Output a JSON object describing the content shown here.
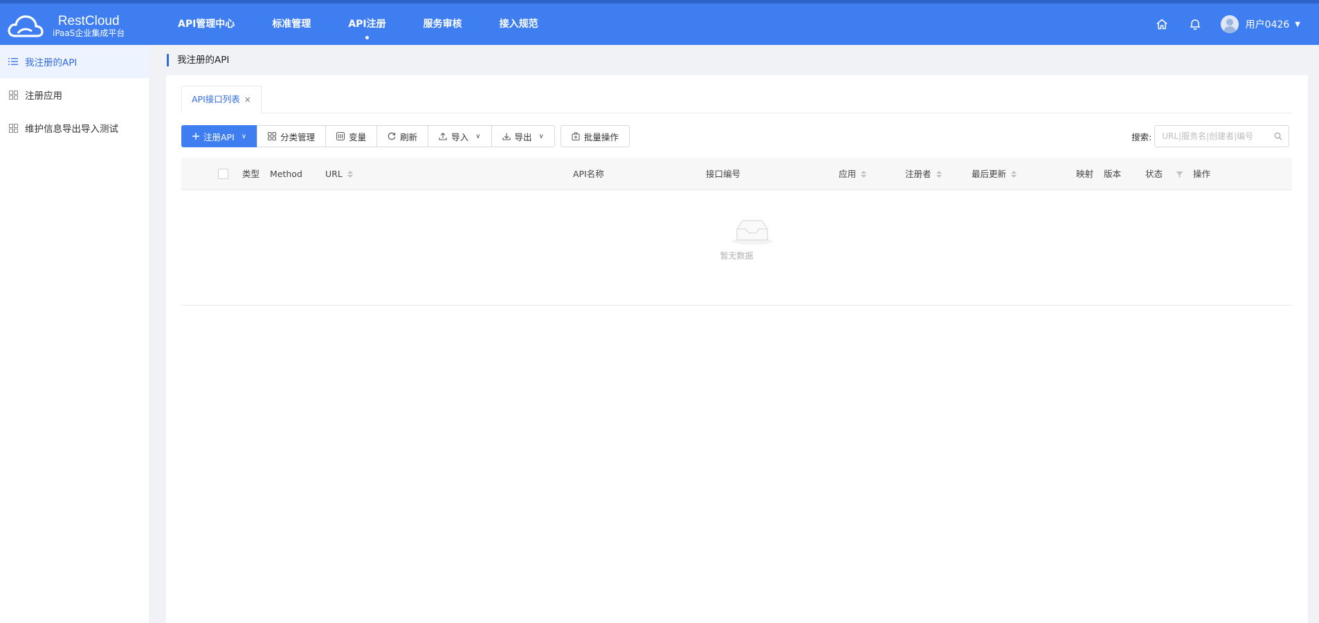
{
  "brand": {
    "title": "RestCloud",
    "subtitle": "iPaaS企业集成平台"
  },
  "nav": [
    {
      "label": "API管理中心"
    },
    {
      "label": "标准管理"
    },
    {
      "label": "API注册",
      "active": true
    },
    {
      "label": "服务审核"
    },
    {
      "label": "接入规范"
    }
  ],
  "user": {
    "name": "用户0426"
  },
  "sidebar": {
    "items": [
      {
        "label": "我注册的API",
        "icon": "list-icon",
        "active": true
      },
      {
        "label": "注册应用",
        "icon": "grid-icon"
      },
      {
        "label": "维护信息导出导入测试",
        "icon": "grid-icon"
      }
    ]
  },
  "page": {
    "title": "我注册的API"
  },
  "tabs": [
    {
      "label": "API接口列表",
      "close": "×"
    }
  ],
  "toolbar": {
    "register": "注册API",
    "category": "分类管理",
    "variables": "变量",
    "refresh": "刷新",
    "import": "导入",
    "export": "导出",
    "batch": "批量操作"
  },
  "search": {
    "label": "搜索:",
    "placeholder": "URL|服务名|创建者|编号"
  },
  "table": {
    "columns": {
      "type": "类型",
      "method": "Method",
      "url": "URL",
      "api_name": "API名称",
      "code": "接口编号",
      "app": "应用",
      "registrant": "注册者",
      "updated": "最后更新",
      "mapping": "映射",
      "version": "版本",
      "status": "状态",
      "actions": "操作"
    },
    "rows": [],
    "empty_text": "暂无数据"
  },
  "colors": {
    "primary": "#3e7ef0",
    "active_text": "#2f6ae0",
    "sidebar_active_bg": "#eef4ff"
  }
}
